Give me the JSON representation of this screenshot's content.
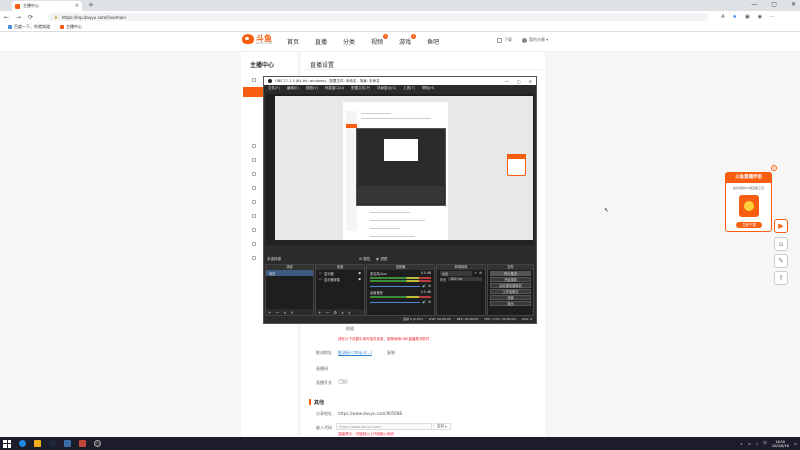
{
  "browser": {
    "tab_title": "主播中心",
    "tab_close": "×",
    "new_tab": "+",
    "window_controls": [
      "—",
      "▢",
      "✕"
    ],
    "back": "←",
    "forward": "→",
    "reload": "⟳",
    "lock": "🔒",
    "url": "https://mp.douyu.com/live/main",
    "bookmarks": [
      "百度一下，你就知道",
      "主播中心"
    ]
  },
  "site": {
    "logo_text": "斗鱼",
    "logo_sub": "DOUYU.COM",
    "nav": [
      {
        "label": "首页",
        "badge": ""
      },
      {
        "label": "直播",
        "badge": ""
      },
      {
        "label": "分类",
        "badge": ""
      },
      {
        "label": "视频",
        "badge": "1"
      },
      {
        "label": "游戏",
        "badge": "1"
      },
      {
        "label": "鱼吧",
        "badge": ""
      }
    ],
    "user": [
      "下载",
      "我的头像"
    ]
  },
  "sidebar": {
    "title": "主播中心",
    "items": [
      "",
      "",
      "",
      "",
      "",
      "",
      "",
      "",
      "",
      "",
      "",
      "",
      ""
    ]
  },
  "content": {
    "page_title": "直播设置",
    "label_partial": "前缀",
    "warning": "请在以下设置中填写相关信息，推荐使用OBS直播推流软件",
    "row1_label": "推流地址",
    "row1_link": "推流码 (rtmp://...)",
    "row1_btn": "复制",
    "row2_label": "直播间",
    "row3_label": "直播开关",
    "section_other": "其他",
    "share_label": "分享地址",
    "share_url": "https://www.douyu.com/905688",
    "embed_label": "嵌入代码",
    "embed_url": "https://www.douyu.com/",
    "embed_btn": "复制",
    "embed_note": "温馨提示：可复制以上代码嵌入网页"
  },
  "obs": {
    "title": "OBS 27.1.3 (64-bit, windows) - 配置文件: 未命名 - 场景: 未命名",
    "win_controls": [
      "—",
      "▢",
      "✕"
    ],
    "menu": [
      "文件(F)",
      "编辑(E)",
      "视图(V)",
      "停靠窗口(D)",
      "配置文件(P)",
      "场景集合(S)",
      "工具(T)",
      "帮助(H)"
    ],
    "toolbar_left": "未选择源",
    "toolbar_btn1": "属性",
    "toolbar_btn2": "滤镜",
    "docks": {
      "scenes": "场景",
      "sources": "来源",
      "mixer": "混音器",
      "transitions": "转场特效",
      "controls": "控件"
    },
    "scene_item": "场景",
    "sources_items": [
      "显示器",
      "显示器采集"
    ],
    "mixer_items": [
      {
        "name": "麦克风/Aux",
        "db": "0.0 dB"
      },
      {
        "name": "桌面音频",
        "db": "0.0 dB"
      }
    ],
    "transition_value": "淡出",
    "duration_label": "时长",
    "duration_value": "300 ms",
    "control_buttons": [
      "停止推流",
      "开始录制",
      "启动虚拟摄像机",
      "工作室模式",
      "设置",
      "退出"
    ],
    "dock_icons": [
      "+",
      "—",
      "⚙",
      "∧",
      "∨"
    ],
    "status": [
      "丢帧 0 (0.0%)",
      "LIVE: 00:00:00",
      "REC: 00:00:00",
      "CPU: 1.5%, 30.00 fps",
      "kb/s: 0"
    ]
  },
  "ad": {
    "title": "斗鱼直播伴侣",
    "close": "×",
    "desc": "最好用的PC端直播工具",
    "button": "立即下载"
  },
  "side_icons": [
    "▶",
    "⌂",
    "✎",
    "⇪"
  ],
  "taskbar": {
    "tray": [
      "∧",
      "▭",
      "♪",
      "中"
    ],
    "time": "16:50",
    "date": "2022/8/16"
  },
  "colors": {
    "brand": "#f95d10",
    "obs_bg": "#2b2b2b",
    "taskbar": "#1c1c2a"
  }
}
